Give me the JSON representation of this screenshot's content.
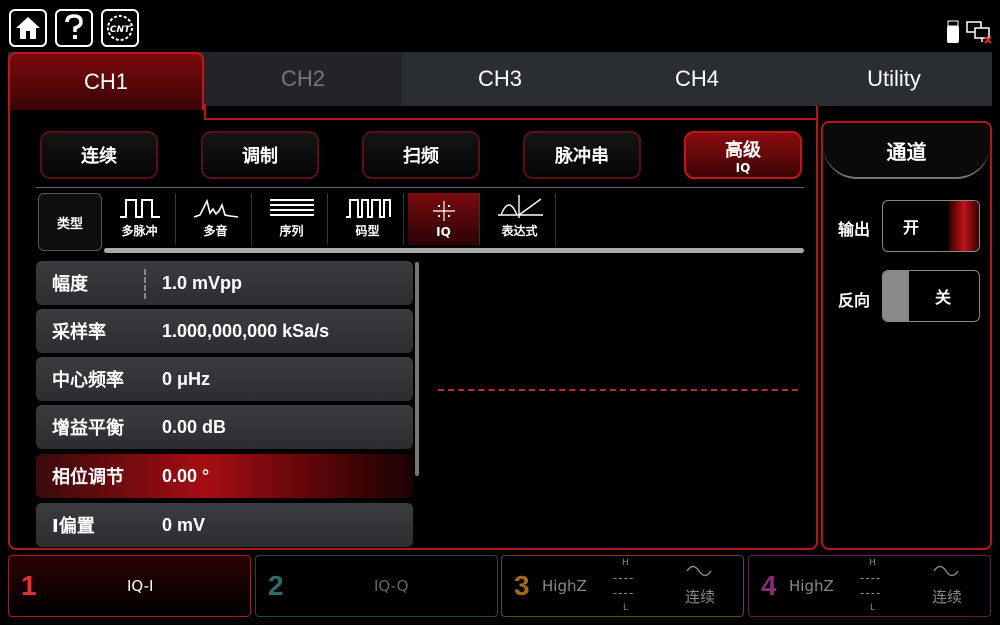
{
  "tabs": [
    "CH1",
    "CH2",
    "CH3",
    "CH4",
    "Utility"
  ],
  "functions": [
    {
      "label": "连续",
      "sub": ""
    },
    {
      "label": "调制",
      "sub": ""
    },
    {
      "label": "扫频",
      "sub": ""
    },
    {
      "label": "脉冲串",
      "sub": ""
    },
    {
      "label": "高级",
      "sub": "IQ"
    }
  ],
  "type_label": "类型",
  "waveforms": [
    "多脉冲",
    "多音",
    "序列",
    "码型",
    "IQ",
    "表达式"
  ],
  "params": [
    {
      "name": "幅度",
      "value": "1.0 mVpp"
    },
    {
      "name": "采样率",
      "value": "1.000,000,000 kSa/s"
    },
    {
      "name": "中心频率",
      "value": "0 μHz"
    },
    {
      "name": "增益平衡",
      "value": "0.00 dB"
    },
    {
      "name": "相位调节",
      "value": "0.00 °"
    },
    {
      "name": "I偏置",
      "value": "0 mV"
    }
  ],
  "side": {
    "title": "通道",
    "output_label": "输出",
    "output_value": "开",
    "invert_label": "反向",
    "invert_value": "关"
  },
  "channels": [
    {
      "num": "1",
      "name": "IQ-I",
      "color": "#e01a20"
    },
    {
      "num": "2",
      "name": "IQ-Q",
      "color": "#2a7070"
    },
    {
      "num": "3",
      "name": "HighZ",
      "h": "H",
      "dash1": "----",
      "dash2": "----",
      "l": "L",
      "mode": "连续",
      "color": "#a06a18"
    },
    {
      "num": "4",
      "name": "HighZ",
      "h": "H",
      "dash1": "----",
      "dash2": "----",
      "l": "L",
      "mode": "连续",
      "color": "#8a2a7a"
    }
  ],
  "logo_text": "CNT"
}
